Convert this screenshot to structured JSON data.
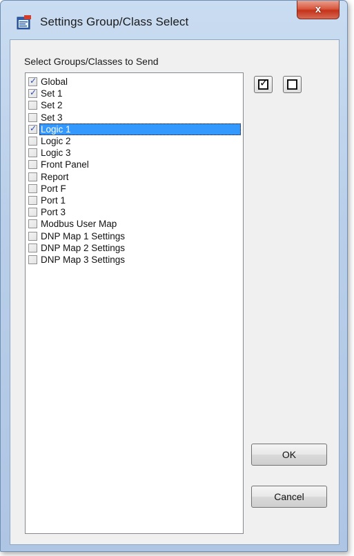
{
  "window": {
    "title": "Settings Group/Class Select",
    "close_label": "x"
  },
  "section_label": "Select Groups/Classes to Send",
  "items": [
    {
      "label": "Global",
      "checked": true,
      "selected": false
    },
    {
      "label": "Set 1",
      "checked": true,
      "selected": false
    },
    {
      "label": "Set 2",
      "checked": false,
      "selected": false
    },
    {
      "label": "Set 3",
      "checked": false,
      "selected": false
    },
    {
      "label": "Logic 1",
      "checked": true,
      "selected": true
    },
    {
      "label": "Logic 2",
      "checked": false,
      "selected": false
    },
    {
      "label": "Logic 3",
      "checked": false,
      "selected": false
    },
    {
      "label": "Front Panel",
      "checked": false,
      "selected": false
    },
    {
      "label": "Report",
      "checked": false,
      "selected": false
    },
    {
      "label": "Port F",
      "checked": false,
      "selected": false
    },
    {
      "label": "Port 1",
      "checked": false,
      "selected": false
    },
    {
      "label": "Port 3",
      "checked": false,
      "selected": false
    },
    {
      "label": "Modbus User Map",
      "checked": false,
      "selected": false
    },
    {
      "label": "DNP Map 1 Settings",
      "checked": false,
      "selected": false
    },
    {
      "label": "DNP Map 2 Settings",
      "checked": false,
      "selected": false
    },
    {
      "label": "DNP Map 3 Settings",
      "checked": false,
      "selected": false
    }
  ],
  "buttons": {
    "ok": "OK",
    "cancel": "Cancel",
    "select_all_icon": "checked-box-icon",
    "clear_all_icon": "empty-box-icon"
  },
  "colors": {
    "selection": "#3399ff",
    "check": "#2a4fb0"
  }
}
